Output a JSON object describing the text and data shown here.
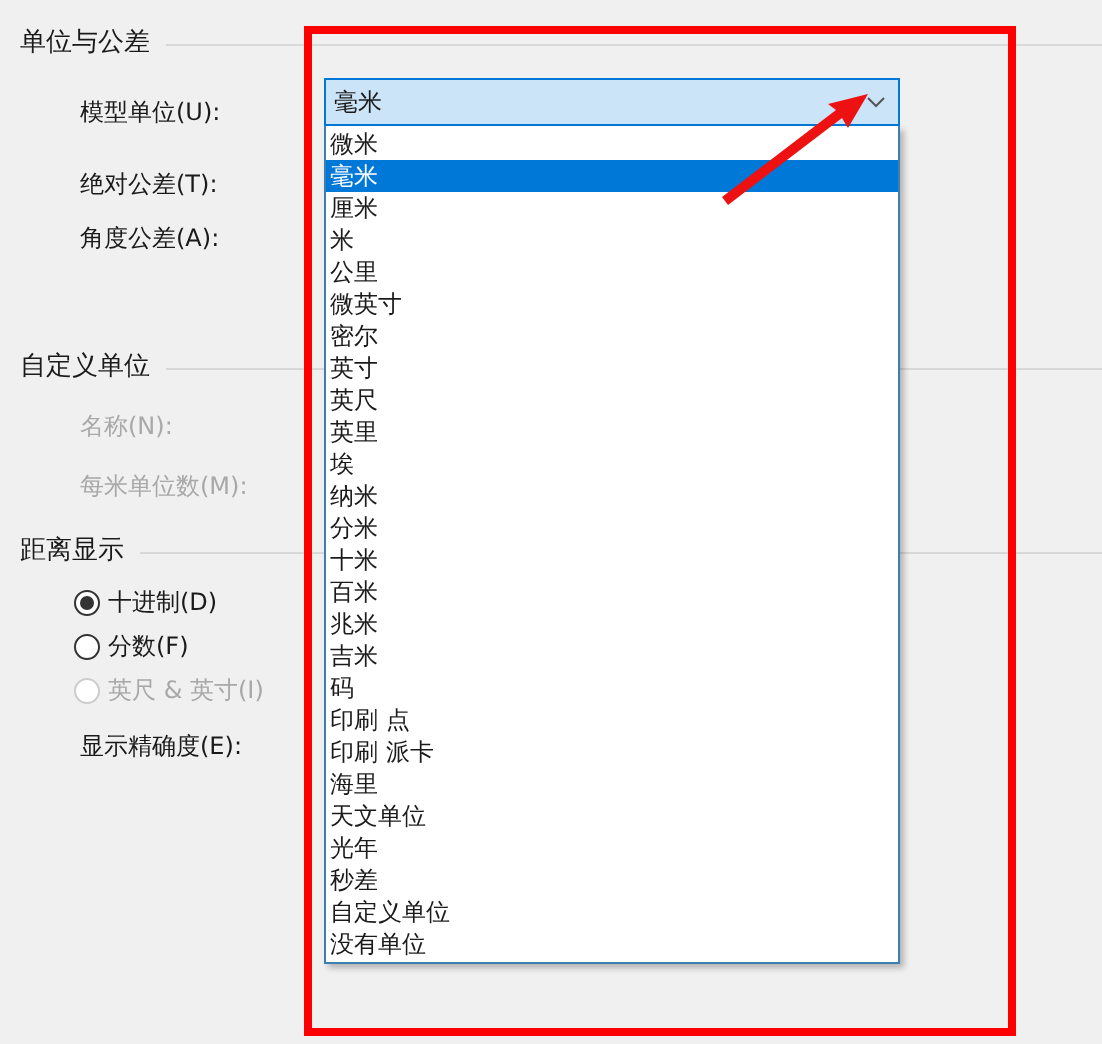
{
  "sections": [
    {
      "title": "单位与公差",
      "rows": [
        {
          "kind": "field",
          "label": "模型单位(U):",
          "disabled": false
        },
        {
          "kind": "field",
          "label": "绝对公差(T):",
          "disabled": false
        },
        {
          "kind": "field",
          "label": "角度公差(A):",
          "disabled": false
        }
      ]
    },
    {
      "title": "自定义单位",
      "rows": [
        {
          "kind": "field",
          "label": "名称(N):",
          "disabled": true
        },
        {
          "kind": "field",
          "label": "每米单位数(M):",
          "disabled": true
        }
      ]
    },
    {
      "title": "距离显示",
      "rows": [
        {
          "kind": "radio",
          "label": "十进制(D)",
          "selected": true,
          "disabled": false
        },
        {
          "kind": "radio",
          "label": "分数(F)",
          "selected": false,
          "disabled": false
        },
        {
          "kind": "radio",
          "label": "英尺 & 英寸(I)",
          "selected": false,
          "disabled": true
        },
        {
          "kind": "field",
          "label": "显示精确度(E):",
          "disabled": false
        }
      ]
    }
  ],
  "unit_dropdown": {
    "value": "毫米",
    "expanded": true,
    "options": [
      {
        "label": "微米",
        "selected": false
      },
      {
        "label": "毫米",
        "selected": true
      },
      {
        "label": "厘米",
        "selected": false
      },
      {
        "label": "米",
        "selected": false
      },
      {
        "label": "公里",
        "selected": false
      },
      {
        "label": "微英寸",
        "selected": false
      },
      {
        "label": "密尔",
        "selected": false
      },
      {
        "label": "英寸",
        "selected": false
      },
      {
        "label": "英尺",
        "selected": false
      },
      {
        "label": "英里",
        "selected": false
      },
      {
        "label": "埃",
        "selected": false
      },
      {
        "label": "纳米",
        "selected": false
      },
      {
        "label": "分米",
        "selected": false
      },
      {
        "label": "十米",
        "selected": false
      },
      {
        "label": "百米",
        "selected": false
      },
      {
        "label": "兆米",
        "selected": false
      },
      {
        "label": "吉米",
        "selected": false
      },
      {
        "label": "码",
        "selected": false
      },
      {
        "label": "印刷 点",
        "selected": false
      },
      {
        "label": "印刷 派卡",
        "selected": false
      },
      {
        "label": "海里",
        "selected": false
      },
      {
        "label": "天文单位",
        "selected": false
      },
      {
        "label": "光年",
        "selected": false
      },
      {
        "label": "秒差",
        "selected": false
      },
      {
        "label": "自定义单位",
        "selected": false
      },
      {
        "label": "没有单位",
        "selected": false
      }
    ]
  }
}
